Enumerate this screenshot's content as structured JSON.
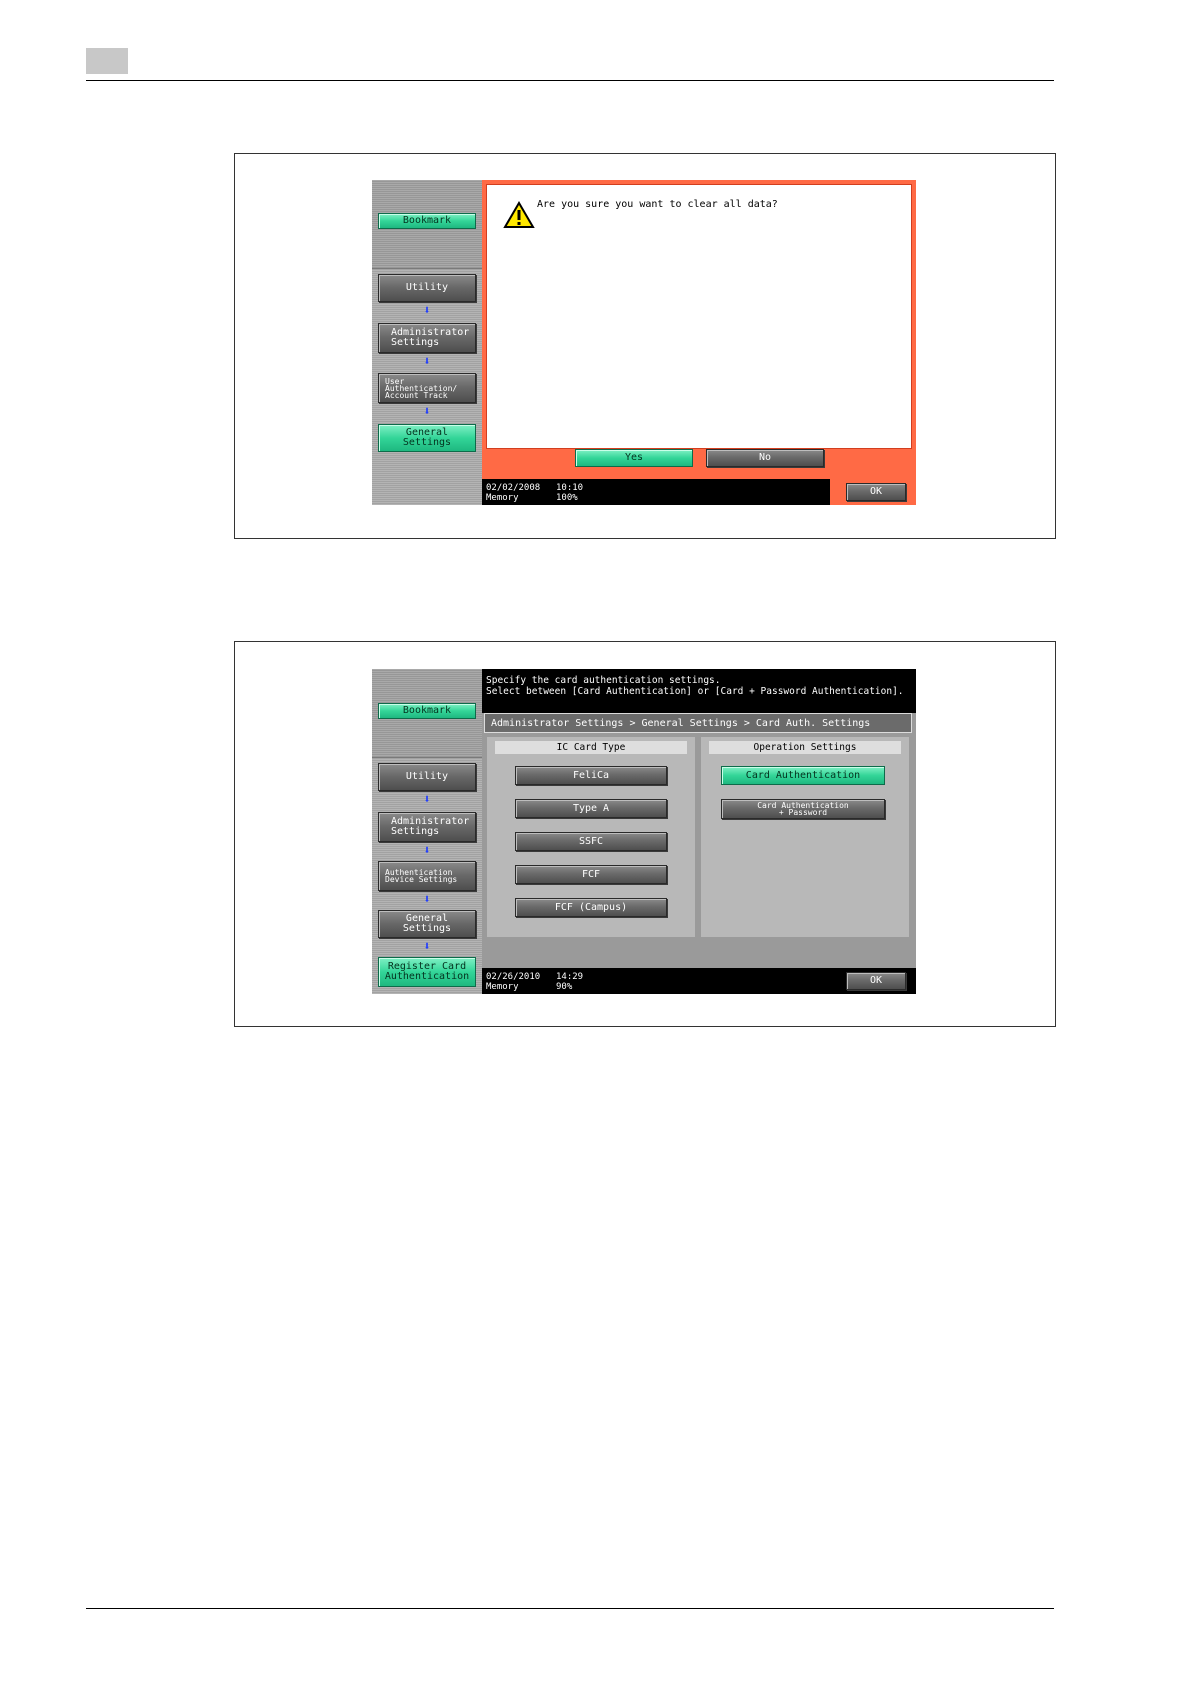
{
  "screen1": {
    "sidebar": {
      "bookmark": "Bookmark",
      "nav": [
        "Utility",
        "Administrator\nSettings",
        "User\nAuthentication/\nAccount Track",
        "General Settings"
      ]
    },
    "dialog": {
      "message": "Are you sure you want to clear all data?",
      "yes": "Yes",
      "no": "No"
    },
    "status": {
      "date": "02/02/2008",
      "time": "10:10",
      "memory_label": "Memory",
      "memory_value": "100%"
    },
    "ok": "OK"
  },
  "screen2": {
    "message_line1": "Specify the card authentication settings.",
    "message_line2": "Select between [Card Authentication] or [Card + Password Authentication].",
    "breadcrumb": "Administrator Settings > General Settings > Card Auth. Settings",
    "sidebar": {
      "bookmark": "Bookmark",
      "nav": [
        "Utility",
        "Administrator\nSettings",
        "Authentication\nDevice Settings",
        "General Settings",
        "Register Card\nAuthentication"
      ]
    },
    "ic_card_type": {
      "title": "IC Card Type",
      "options": [
        "FeliCa",
        "Type A",
        "SSFC",
        "FCF",
        "FCF (Campus)"
      ]
    },
    "operation_settings": {
      "title": "Operation Settings",
      "options": [
        "Card Authentication",
        "Card Authentication\n+ Password"
      ]
    },
    "status": {
      "date": "02/26/2010",
      "time": "14:29",
      "memory_label": "Memory",
      "memory_value": "90%"
    },
    "ok": "OK"
  },
  "colors": {
    "accent_green": "#33d598",
    "dialog_border": "#ff6a45",
    "arrow_blue": "#1f3cff"
  },
  "icons": [
    "warning-icon",
    "down-arrow-icon"
  ]
}
